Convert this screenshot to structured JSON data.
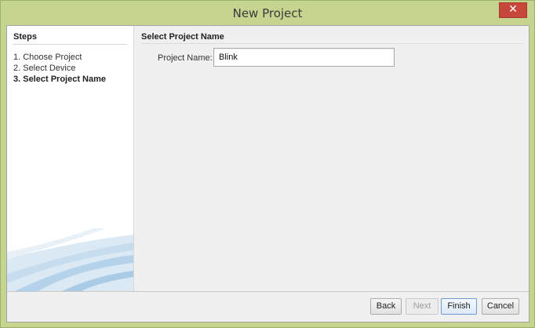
{
  "window": {
    "title": "New Project",
    "close_glyph": "✕"
  },
  "steps": {
    "header": "Steps",
    "items": [
      {
        "label": "1. Choose Project"
      },
      {
        "label": "2. Select Device"
      },
      {
        "label": "3. Select Project Name",
        "current": true
      }
    ]
  },
  "content": {
    "header": "Select Project Name",
    "project_name_label": "Project Name:",
    "project_name_value": "Blink"
  },
  "buttons": {
    "back": "Back",
    "next": "Next",
    "finish": "Finish",
    "cancel": "Cancel"
  },
  "colors": {
    "titlebar": "#c5d58f",
    "close": "#c7473b",
    "accent": "#6f9bd1"
  },
  "icons": {
    "close": "close-icon",
    "decoration": "swoosh-decoration"
  }
}
